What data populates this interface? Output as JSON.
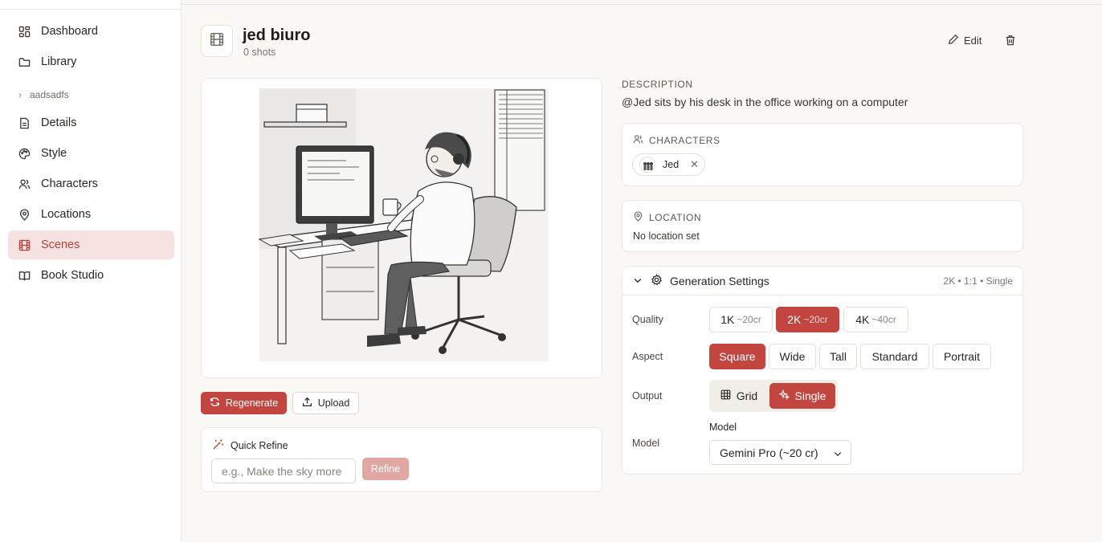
{
  "sidebar": {
    "items": [
      {
        "label": "Dashboard",
        "icon": "dashboard-icon"
      },
      {
        "label": "Library",
        "icon": "folder-icon"
      }
    ],
    "group": {
      "label": "aadsadfs"
    },
    "project_items": [
      {
        "label": "Details",
        "icon": "file-icon"
      },
      {
        "label": "Style",
        "icon": "palette-icon"
      },
      {
        "label": "Characters",
        "icon": "users-icon"
      },
      {
        "label": "Locations",
        "icon": "map-pin-icon"
      },
      {
        "label": "Scenes",
        "icon": "film-icon",
        "active": true
      },
      {
        "label": "Book Studio",
        "icon": "book-open-icon"
      }
    ]
  },
  "scene": {
    "title": "jed biuro",
    "shots": "0 shots",
    "edit_label": "Edit",
    "image_alt": "Sketch of a man with headphones working at a computer desk"
  },
  "actions": {
    "regenerate_label": "Regenerate",
    "upload_label": "Upload"
  },
  "refine": {
    "title": "Quick Refine",
    "placeholder": "e.g., Make the sky more",
    "button_label": "Refine"
  },
  "description": {
    "label": "DESCRIPTION",
    "text": "@Jed sits by his desk in the office working on a computer"
  },
  "characters": {
    "label": "CHARACTERS",
    "chips": [
      {
        "name": "Jed"
      }
    ]
  },
  "location": {
    "label": "LOCATION",
    "value": "No location set"
  },
  "generation": {
    "title": "Generation Settings",
    "summary": "2K • 1:1 • Single",
    "quality_label": "Quality",
    "quality_options": [
      {
        "label": "1K",
        "cost": "~20cr",
        "selected": false
      },
      {
        "label": "2K",
        "cost": "~20cr",
        "selected": true
      },
      {
        "label": "4K",
        "cost": "~40cr",
        "selected": false
      }
    ],
    "aspect_label": "Aspect",
    "aspect_options": [
      {
        "label": "Square",
        "selected": true
      },
      {
        "label": "Wide",
        "selected": false
      },
      {
        "label": "Tall",
        "selected": false
      },
      {
        "label": "Standard",
        "selected": false
      },
      {
        "label": "Portrait",
        "selected": false
      }
    ],
    "output_label": "Output",
    "output_options": [
      {
        "label": "Grid",
        "selected": false
      },
      {
        "label": "Single",
        "selected": true
      }
    ],
    "model_label": "Model",
    "model_caption": "Model",
    "model_value": "Gemini Pro (~20 cr)"
  },
  "colors": {
    "accent": "#c2463f",
    "accent_light": "#f6e3e1",
    "background": "#faf8f4"
  }
}
